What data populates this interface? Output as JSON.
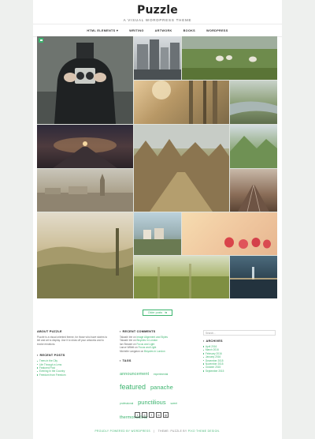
{
  "site": {
    "title": "Puzzle",
    "tagline": "A VISUAL WORDPRESS THEME"
  },
  "nav": {
    "items": [
      "HTML ELEMENTS",
      "WRITING",
      "ARTWORK",
      "BOOKS",
      "WORDPRESS"
    ]
  },
  "pagination": {
    "older_label": "Older posts"
  },
  "about": {
    "title": "ABOUT PUZZLE",
    "text": "Puzzle is a visual oriented theme, for those who have stories to tell and art to display. Use it to show off your artworks and to evoke emotions."
  },
  "recent_posts": {
    "title": "RECENT POSTS",
    "items": [
      "Trees in the City",
      "Life Through a Lens",
      "Featured Post",
      "Evening In the Country",
      "Freedom from Freedom"
    ]
  },
  "recent_comments": {
    "title": "RECENT COMMENTS",
    "items": [
      {
        "author": "Takashi Irie",
        "on": "on",
        "post": "Image Alignment and Styles"
      },
      {
        "author": "Takashi Irie",
        "on": "on",
        "post": "Bicycles in London"
      },
      {
        "author": "Ian Stewart",
        "on": "on",
        "post": "Focus and Light"
      },
      {
        "author": "Lance Willett",
        "on": "on",
        "post": "Focus and Light"
      },
      {
        "author": "Michelle Langston",
        "on": "on",
        "post": "Bicycles in London"
      }
    ]
  },
  "tags": {
    "title": "TAGS",
    "items": [
      {
        "label": "announcement",
        "size": 5.6
      },
      {
        "label": "experimental",
        "size": 3.2
      },
      {
        "label": "featured",
        "size": 9.0
      },
      {
        "label": "panache",
        "size": 7.5
      },
      {
        "label": "professional",
        "size": 3.2
      },
      {
        "label": "punctilious",
        "size": 7.5
      },
      {
        "label": "sweet",
        "size": 3.2
      },
      {
        "label": "thermonuclear",
        "size": 5.6
      }
    ]
  },
  "search": {
    "placeholder": "Search..."
  },
  "archives": {
    "title": "ARCHIVES",
    "items": [
      "April 2016",
      "March 2016",
      "February 2016",
      "January 2016",
      "December 2015",
      "November 2015",
      "October 2015",
      "September 2015"
    ]
  },
  "social": {
    "items": [
      "twitter-icon",
      "instagram-icon",
      "facebook-icon",
      "linkedin-icon",
      "dribbble-icon"
    ]
  },
  "footer": {
    "powered": "PROUDLY POWERED BY WORDPRESS",
    "sep": "|",
    "theme": "THEME: PUZZLE BY",
    "author": "PIXO THEME DESIGN."
  },
  "colors": {
    "accent": "#3cb46e",
    "page": "#ffffff",
    "background": "#eef0ee",
    "text": "#333333"
  }
}
